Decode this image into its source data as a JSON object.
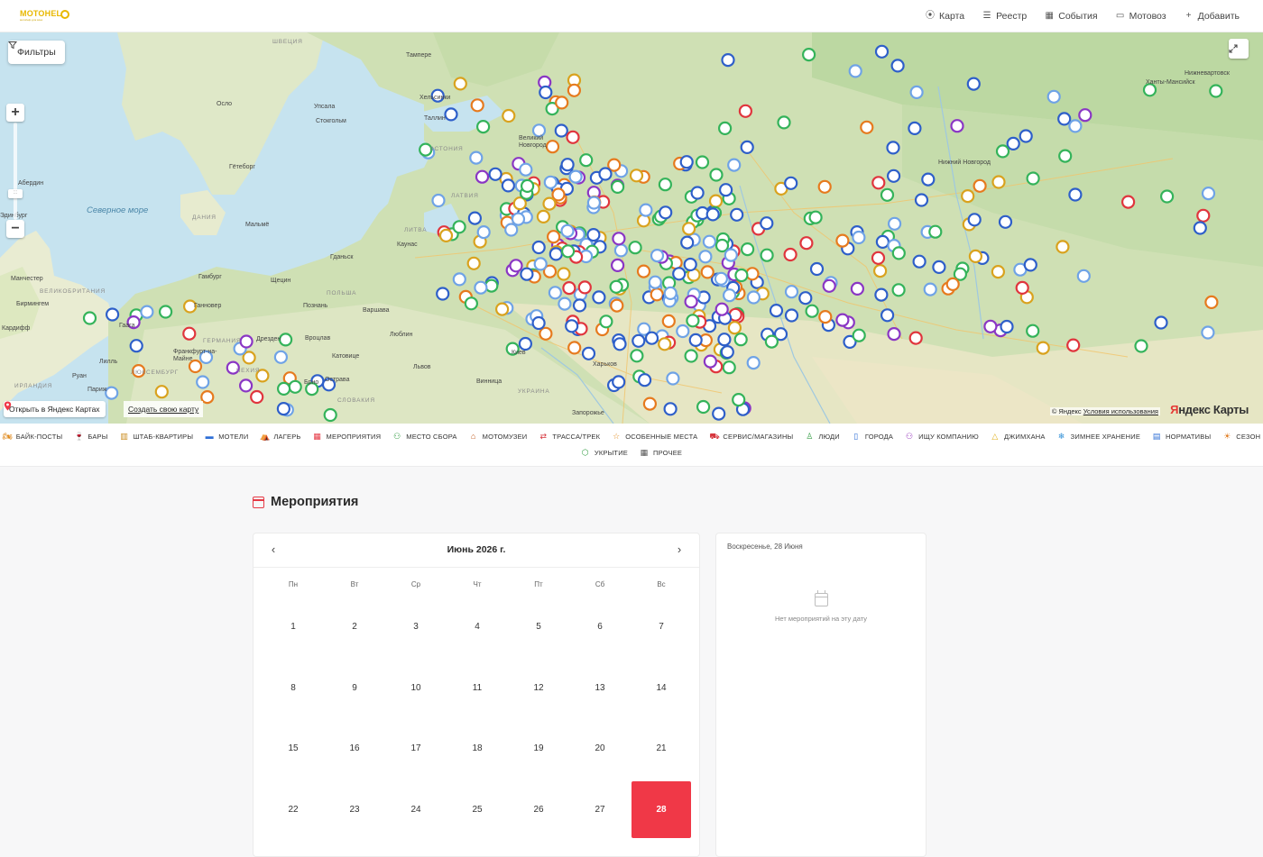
{
  "header": {
    "logo_text": "MOTOHEL",
    "logo_subtext": "мотоhelp для всех",
    "nav": [
      {
        "label": "Карта",
        "icon": "map-pin-icon"
      },
      {
        "label": "Реестр",
        "icon": "list-icon"
      },
      {
        "label": "События",
        "icon": "calendar-icon"
      },
      {
        "label": "Мотовоз",
        "icon": "truck-icon"
      },
      {
        "label": "Добавить",
        "icon": "plus-icon"
      }
    ]
  },
  "map": {
    "filter_label": "Фильтры",
    "zoom_in": "+",
    "zoom_out": "−",
    "open_in_yandex": "Открыть в Яндекс Картах",
    "create_map": "Создать свою карту",
    "copyright_prefix": "© Яндекс",
    "copyright_link": "Условия использования",
    "yandex_logo_first": "Я",
    "yandex_logo_rest": "ндекс Карты",
    "seas": [
      {
        "name": "Северное море"
      }
    ],
    "labels": [
      "Тампере",
      "Осло",
      "Упсала",
      "Стокгольм",
      "Хельсинки",
      "Таллин",
      "Гётеборг",
      "Абердин",
      "Эдинбург",
      "Мальмё",
      "Рига",
      "Гамбург",
      "Щецин",
      "Ганновер",
      "Гданьск",
      "Познань",
      "Варшава",
      "Манчестер",
      "Бирмингем",
      "Кардифф",
      "Лондон",
      "Амстердам",
      "Гаага",
      "Лилль",
      "Париж",
      "Руан",
      "Брюссель",
      "Франкфурт-на-Майне",
      "Дрезден",
      "Вроцлав",
      "Катовице",
      "Люблин",
      "Львов",
      "Брно",
      "Острава",
      "Винница",
      "Киев",
      "Харьков",
      "Запорожье",
      "Великий Новгород",
      "Нижний Новгород",
      "Саратов",
      "Самара",
      "Уфа",
      "Пермь",
      "Ханты-Мансийск",
      "Нижневартовск",
      "Каунас",
      "Вена"
    ],
    "countries": [
      "ШВЕЦИЯ",
      "ЭСТОНИЯ",
      "ЛАТВИЯ",
      "ЛИТВА",
      "ДАНИЯ",
      "ПОЛЬША",
      "ГЕРМАНИЯ",
      "ВЕЛИКОБРИТАНИЯ",
      "ЧЕХИЯ",
      "СЛОВАКИЯ",
      "УКРАИНА",
      "ЛЮКСЕМБУРГ",
      "ИРЛАНДИЯ"
    ]
  },
  "categories_row1": [
    {
      "label": "Байк-посты",
      "icon": "motorcycle-icon",
      "color": "#e08a1e"
    },
    {
      "label": "Бары",
      "icon": "glass-icon",
      "color": "#9b3fbf"
    },
    {
      "label": "Штаб-квартиры",
      "icon": "building-icon",
      "color": "#c98a1c"
    },
    {
      "label": "Мотели",
      "icon": "bed-icon",
      "color": "#2f6fd6"
    },
    {
      "label": "Лагерь",
      "icon": "tent-icon",
      "color": "#3a9a4a"
    },
    {
      "label": "Мероприятия",
      "icon": "calendar-icon",
      "color": "#e53945"
    },
    {
      "label": "Место сбора",
      "icon": "group-icon",
      "color": "#3aa04a"
    },
    {
      "label": "Мотомузеи",
      "icon": "museum-icon",
      "color": "#c0591c"
    },
    {
      "label": "Трасса/Трек",
      "icon": "track-icon",
      "color": "#d6363e"
    },
    {
      "label": "Особенные места",
      "icon": "star-icon",
      "color": "#e08a1e"
    },
    {
      "label": "Сервис/Магазины",
      "icon": "cart-icon",
      "color": "#d6363e"
    },
    {
      "label": "Люди",
      "icon": "person-icon",
      "color": "#3aa04a"
    },
    {
      "label": "Города",
      "icon": "city-icon",
      "color": "#2f6fd6"
    },
    {
      "label": "Ищу компанию",
      "icon": "user-plus-icon",
      "color": "#9b3fbf"
    },
    {
      "label": "Джимхана",
      "icon": "cone-icon",
      "color": "#e0b01e"
    },
    {
      "label": "Зимнее хранение",
      "icon": "snowflake-icon",
      "color": "#2f8fd6"
    },
    {
      "label": "Нормативы",
      "icon": "clipboard-icon",
      "color": "#2f6fd6"
    },
    {
      "label": "Сезон",
      "icon": "sun-icon",
      "color": "#e07a1e"
    }
  ],
  "categories_row2": [
    {
      "label": "Укрытие",
      "icon": "shield-icon",
      "color": "#3aa04a"
    },
    {
      "label": "Прочее",
      "icon": "grid-icon",
      "color": "#555555"
    }
  ],
  "events": {
    "title": "Мероприятия",
    "month_label": "Июнь 2026 г.",
    "weekdays": [
      "Пн",
      "Вт",
      "Ср",
      "Чт",
      "Пт",
      "Сб",
      "Вс"
    ],
    "days": [
      "1",
      "2",
      "3",
      "4",
      "5",
      "6",
      "7",
      "8",
      "9",
      "10",
      "11",
      "12",
      "13",
      "14",
      "15",
      "16",
      "17",
      "18",
      "19",
      "20",
      "21",
      "22",
      "23",
      "24",
      "25",
      "26",
      "27",
      "28"
    ],
    "selected_day": "28",
    "selected_date_label": "Воскресенье, 28 Июня",
    "empty_text": "Нет мероприятий на эту дату"
  },
  "marker_colors": {
    "blue": "#2e5fc9",
    "lightblue": "#6fa3e6",
    "green": "#34b35a",
    "orange": "#e67a1e",
    "red": "#e0353d",
    "purple": "#8a36c4",
    "yellow": "#d9a21e"
  }
}
